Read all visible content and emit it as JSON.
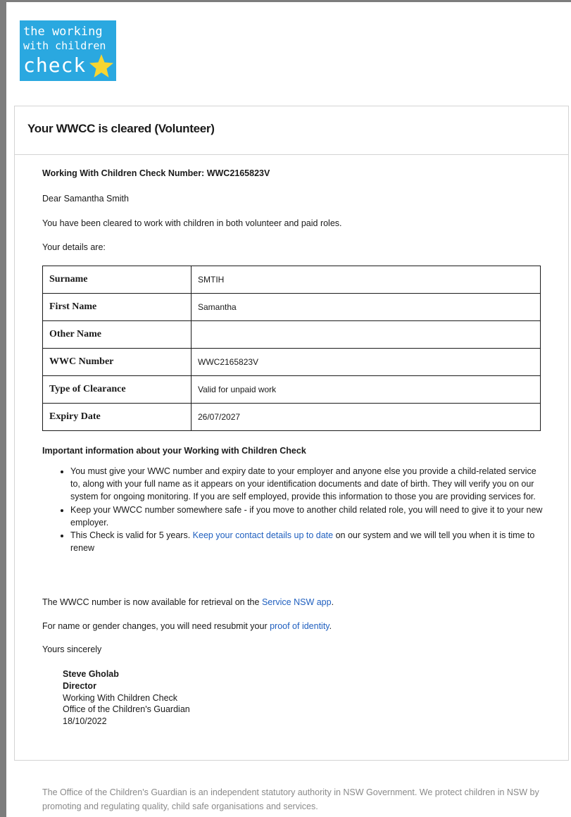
{
  "logo": {
    "line1": "the working",
    "line2": "with children",
    "line3": "check",
    "background_color": "#2aa8e0",
    "star_color": "#f7d531",
    "star_icon": "star-icon"
  },
  "card": {
    "title": "Your WWCC is cleared (Volunteer)"
  },
  "letter": {
    "check_number_heading": "Working With Children Check Number: WWC2165823V",
    "greeting": "Dear Samantha Smith",
    "intro": "You have been cleared to work with children in both volunteer and paid roles.",
    "details_intro": "Your details are:",
    "details": [
      {
        "label": "Surname",
        "value": "SMTIH"
      },
      {
        "label": "First Name",
        "value": "Samantha"
      },
      {
        "label": "Other Name",
        "value": ""
      },
      {
        "label": "WWC Number",
        "value": "WWC2165823V"
      },
      {
        "label": "Type of Clearance",
        "value": "Valid for unpaid work"
      },
      {
        "label": "Expiry Date",
        "value": "26/07/2027"
      }
    ],
    "important_heading": "Important information about your Working with Children Check",
    "bullets": {
      "b1": "You must give your WWC number and expiry date to your employer and anyone else you provide a child-related service to, along with your full name as it appears on your identification documents and date of birth. They will verify you on our system for ongoing monitoring. If you are self employed, provide this information to those you are providing services for.",
      "b2": "Keep your WWCC number somewhere safe - if you move to another child related role, you will need to give it to your new employer.",
      "b3_pre": "This Check is valid for 5 years. ",
      "b3_link": "Keep your contact details up to date",
      "b3_post": " on our system and we will tell you when it is time to renew"
    },
    "app_pre": "The WWCC number is now available for retrieval on the ",
    "app_link": "Service NSW app",
    "app_post": ".",
    "identity_pre": "For name or gender changes, you will need resubmit your ",
    "identity_link": "proof of identity",
    "identity_post": ".",
    "closing": "Yours sincerely",
    "signature": {
      "name": "Steve Gholab",
      "title": "Director",
      "unit": "Working With Children Check",
      "office": "Office of the Children's Guardian",
      "date": "18/10/2022"
    }
  },
  "footer": {
    "text": "The Office of the Children's Guardian is an independent statutory authority in NSW Government. We protect children in NSW by promoting and regulating quality, child safe organisations and services."
  },
  "colors": {
    "link": "#1f5fbf",
    "footer_text": "#8a8a8a",
    "window_border": "#7d7d7d"
  }
}
